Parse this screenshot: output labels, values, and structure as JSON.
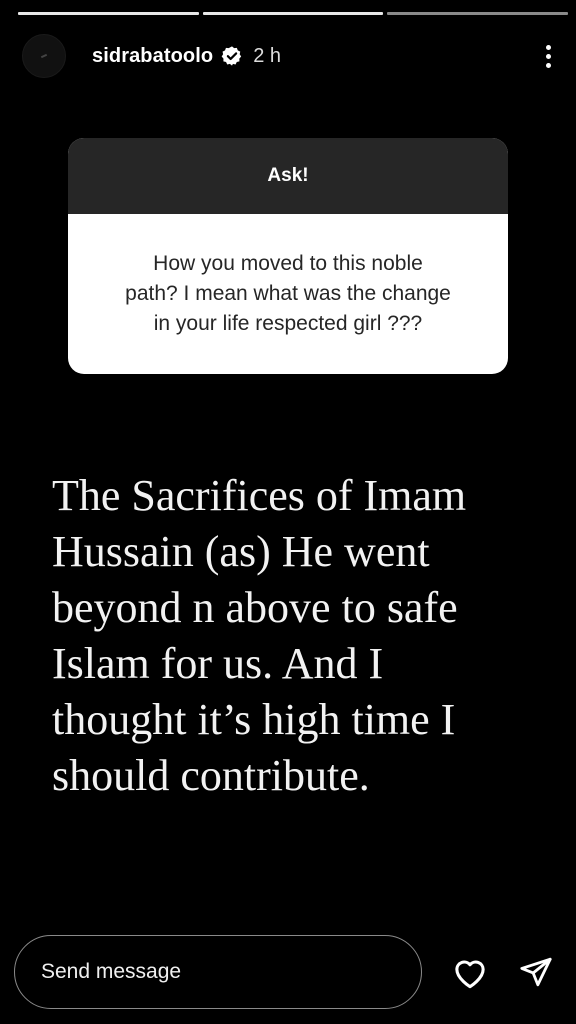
{
  "story": {
    "progress_segments": 3,
    "active_segment_index": 2
  },
  "header": {
    "username": "sidrabatoolo",
    "time": "2 h",
    "verified_icon": "verified-badge-icon",
    "more_icon": "more-vertical-icon"
  },
  "question_sticker": {
    "title": "Ask!",
    "question_lines": [
      "How you moved to this noble",
      "path? I mean what was the change",
      "in your life respected girl ???"
    ]
  },
  "caption": {
    "lines": [
      "The Sacrifices of Imam",
      "Hussain (as) He went",
      "beyond n above to safe",
      "Islam for us. And I",
      "thought it’s high time I",
      "should contribute."
    ]
  },
  "footer": {
    "message_placeholder": "Send message",
    "like_icon": "heart-icon",
    "share_icon": "send-icon"
  }
}
